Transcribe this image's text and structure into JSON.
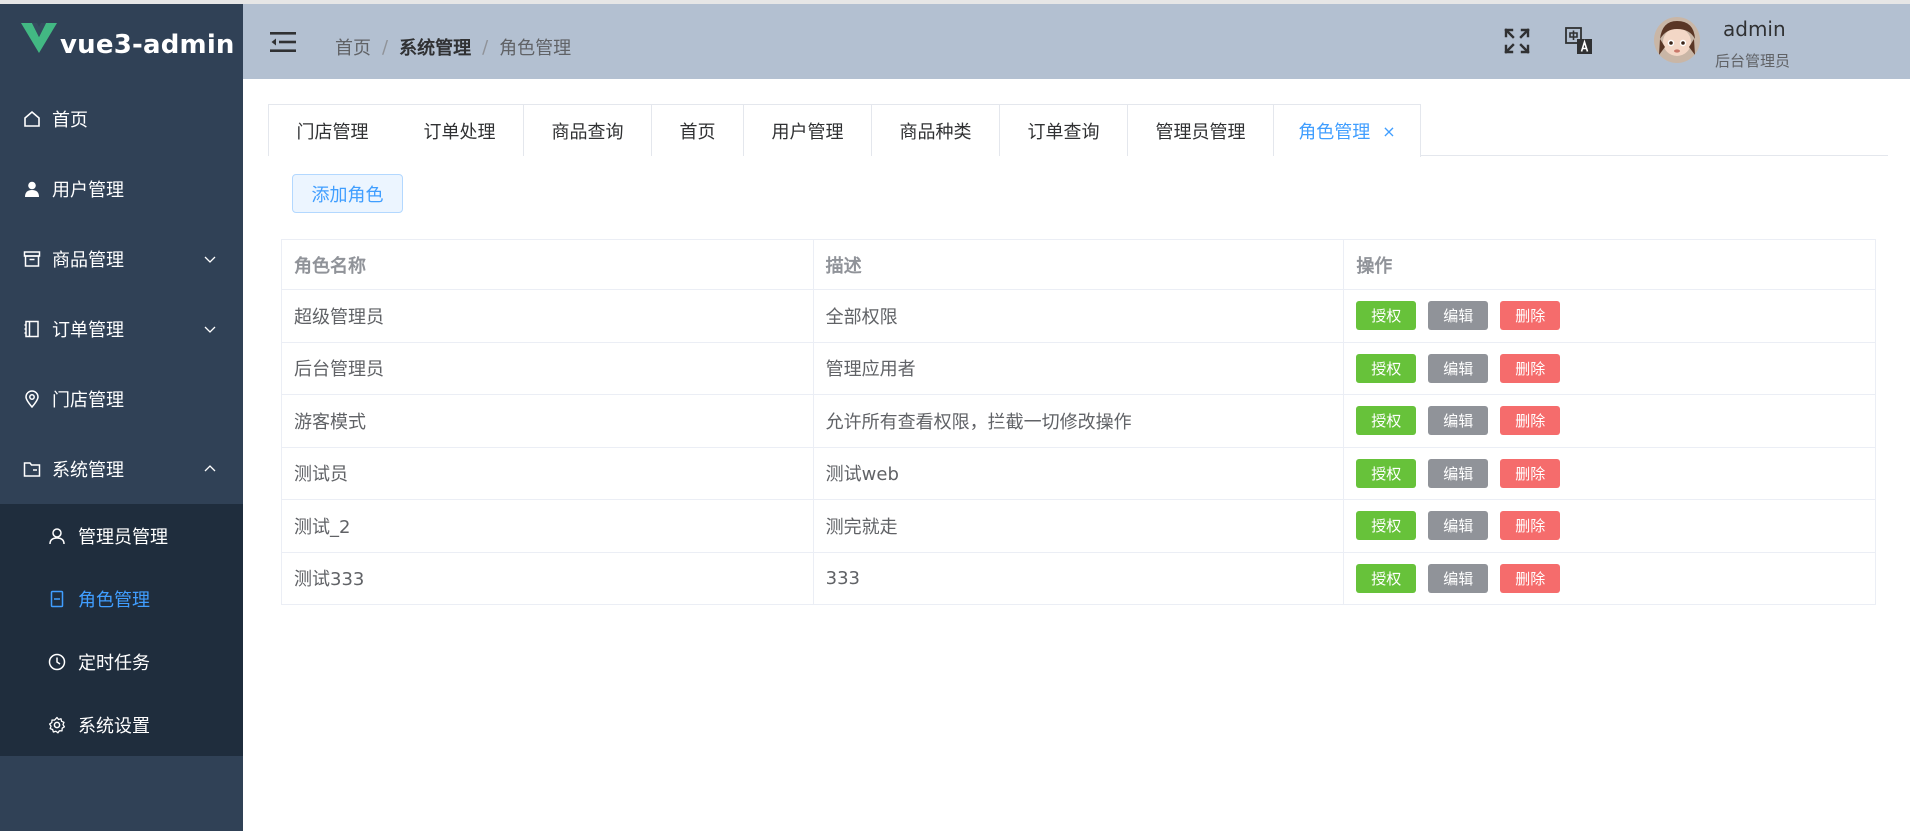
{
  "app": {
    "logo_text": "vue3-admin"
  },
  "sidebar": {
    "items": [
      {
        "label": "首页"
      },
      {
        "label": "用户管理"
      },
      {
        "label": "商品管理"
      },
      {
        "label": "订单管理"
      },
      {
        "label": "门店管理"
      },
      {
        "label": "系统管理"
      }
    ],
    "sub_items": [
      {
        "label": "管理员管理"
      },
      {
        "label": "角色管理"
      },
      {
        "label": "定时任务"
      },
      {
        "label": "系统设置"
      }
    ]
  },
  "header": {
    "breadcrumb": [
      "首页",
      "系统管理",
      "角色管理"
    ],
    "breadcrumb_sep": "/",
    "user_name": "admin",
    "user_role": "后台管理员"
  },
  "tabs": [
    {
      "label": "门店管理"
    },
    {
      "label": "订单处理"
    },
    {
      "label": "商品查询"
    },
    {
      "label": "首页"
    },
    {
      "label": "用户管理"
    },
    {
      "label": "商品种类"
    },
    {
      "label": "订单查询"
    },
    {
      "label": "管理员管理"
    },
    {
      "label": "角色管理",
      "close": "×"
    }
  ],
  "content": {
    "add_button": "添加角色",
    "table": {
      "headers": [
        "角色名称",
        "描述",
        "操作"
      ],
      "rows": [
        {
          "name": "超级管理员",
          "desc": "全部权限"
        },
        {
          "name": "后台管理员",
          "desc": "管理应用者"
        },
        {
          "name": "游客模式",
          "desc": "允许所有查看权限，拦截一切修改操作"
        },
        {
          "name": "测试员",
          "desc": "测试web"
        },
        {
          "name": "测试_2",
          "desc": "测完就走"
        },
        {
          "name": "测试333",
          "desc": "333"
        }
      ],
      "actions": {
        "grant": "授权",
        "edit": "编辑",
        "delete": "删除"
      }
    }
  },
  "colors": {
    "sidebar_bg": "#304156",
    "submenu_bg": "#1f2d3d",
    "header_bg": "#b3c0d1",
    "accent": "#409eff",
    "success": "#67c23a",
    "info": "#909399",
    "danger": "#f56c6c"
  }
}
